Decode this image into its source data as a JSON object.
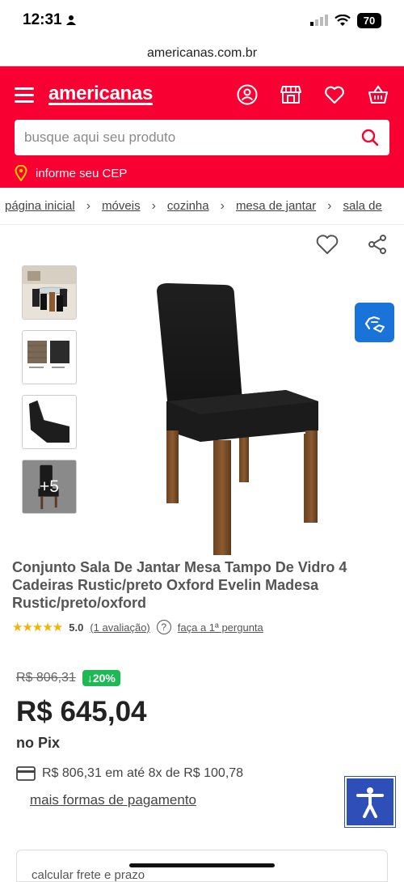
{
  "status_bar": {
    "time": "12:31",
    "battery": "70"
  },
  "browser": {
    "url": "americanas.com.br"
  },
  "header": {
    "logo": "americanas",
    "search_placeholder": "busque aqui seu produto",
    "cep_label": "informe seu CEP",
    "icons": [
      "user-icon",
      "store-icon",
      "heart-icon",
      "basket-icon"
    ]
  },
  "breadcrumb": [
    "página inicial",
    "móveis",
    "cozinha",
    "mesa de jantar",
    "sala de"
  ],
  "gallery": {
    "more_label": "+5"
  },
  "product": {
    "title": "Conjunto Sala De Jantar Mesa Tampo De Vidro 4 Cadeiras Rustic/preto Oxford Evelin Madesa Rustic/preto/oxford",
    "rating_value": "5.0",
    "rating_count": "(1 avaliação)",
    "question_link": "faça a 1ª pergunta"
  },
  "price": {
    "old": "R$ 806,31",
    "discount": "↓20%",
    "current": "R$ 645,04",
    "method": "no Pix",
    "installments": "R$ 806,31 em até 8x de R$ 100,78",
    "more_payment": "mais formas de pagamento"
  },
  "freight": {
    "label": "calcular frete e prazo"
  },
  "colors": {
    "brand": "#f80032",
    "discount": "#1db954",
    "accessibility": "#2f4fb8"
  }
}
